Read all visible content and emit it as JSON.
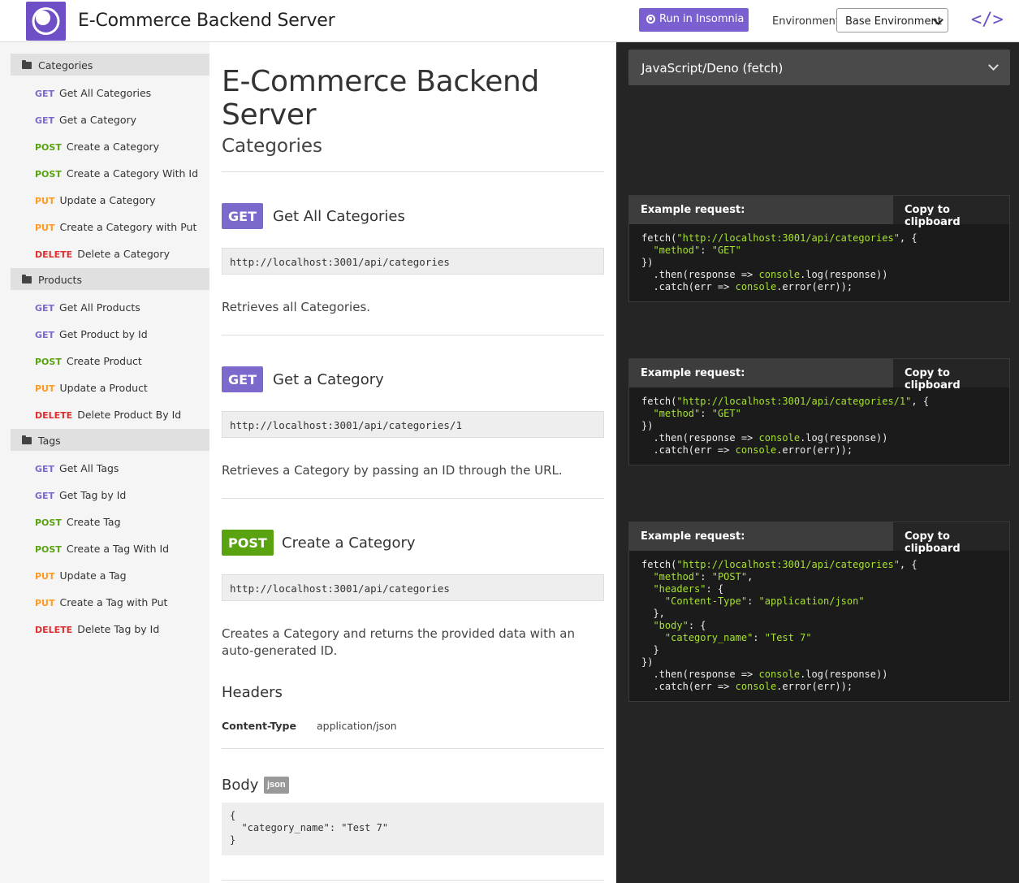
{
  "header": {
    "title": "E-Commerce Backend Server",
    "run_button": "Run in Insomnia",
    "env_label": "Environment:",
    "env_value": "Base Environment",
    "code_toggle": "</>"
  },
  "sidebar": {
    "folders": [
      {
        "label": "Categories",
        "items": [
          {
            "method": "GET",
            "label": "Get All Categories"
          },
          {
            "method": "GET",
            "label": "Get a Category"
          },
          {
            "method": "POST",
            "label": "Create a Category"
          },
          {
            "method": "POST",
            "label": "Create a Category With Id"
          },
          {
            "method": "PUT",
            "label": "Update a Category"
          },
          {
            "method": "PUT",
            "label": "Create a Category with Put"
          },
          {
            "method": "DELETE",
            "label": "Delete a Category"
          }
        ]
      },
      {
        "label": "Products",
        "items": [
          {
            "method": "GET",
            "label": "Get All Products"
          },
          {
            "method": "GET",
            "label": "Get Product by Id"
          },
          {
            "method": "POST",
            "label": "Create Product"
          },
          {
            "method": "PUT",
            "label": "Update a Product"
          },
          {
            "method": "DELETE",
            "label": "Delete Product By Id"
          }
        ]
      },
      {
        "label": "Tags",
        "items": [
          {
            "method": "GET",
            "label": "Get All Tags"
          },
          {
            "method": "GET",
            "label": "Get Tag by Id"
          },
          {
            "method": "POST",
            "label": "Create Tag"
          },
          {
            "method": "POST",
            "label": "Create a Tag With Id"
          },
          {
            "method": "PUT",
            "label": "Update a Tag"
          },
          {
            "method": "PUT",
            "label": "Create a Tag with Put"
          },
          {
            "method": "DELETE",
            "label": "Delete Tag by Id"
          }
        ]
      }
    ]
  },
  "main": {
    "page_title": "E-Commerce Backend Server",
    "section_title": "Categories",
    "requests": [
      {
        "method": "GET",
        "title": "Get All Categories",
        "url": "http://localhost:3001/api/categories",
        "description": "Retrieves all Categories."
      },
      {
        "method": "GET",
        "title": "Get a Category",
        "url": "http://localhost:3001/api/categories/1",
        "description": "Retrieves a Category by passing an ID through the URL."
      },
      {
        "method": "POST",
        "title": "Create a Category",
        "url": "http://localhost:3001/api/categories",
        "description": "Creates a Category and returns the provided data with an auto-generated ID.",
        "headers_title": "Headers",
        "header_key": "Content-Type",
        "header_value": "application/json",
        "body_title": "Body",
        "body_tag": "json",
        "body": "{\n  \"category_name\": \"Test 7\"\n}"
      }
    ]
  },
  "right": {
    "language": "JavaScript/Deno (fetch)",
    "example_label": "Example request:",
    "copy_label": "Copy to clipboard",
    "examples": [
      {
        "url": "http://localhost:3001/api/categories",
        "method": "GET"
      },
      {
        "url": "http://localhost:3001/api/categories/1",
        "method": "GET"
      },
      {
        "url": "http://localhost:3001/api/categories",
        "method": "POST",
        "content_type_key": "Content-Type",
        "content_type_val": "application/json",
        "body_key": "category_name",
        "body_val": "Test 7"
      }
    ]
  },
  "colors": {
    "accent": "#7a5fd1",
    "get": "#7d69cb",
    "post": "#59a210",
    "put": "#ff9a1f",
    "delete": "#dd2f2f",
    "code_string": "#a7e22e"
  }
}
